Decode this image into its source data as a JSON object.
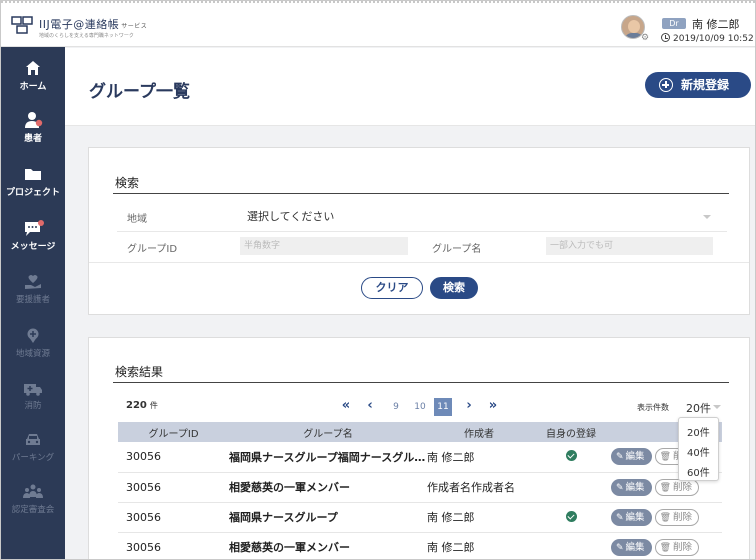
{
  "app": {
    "brand": "IIJ電子@連絡帳",
    "brand_suffix": "サービス",
    "tagline": "地域のくらしを支える専門職ネットワーク"
  },
  "user": {
    "badge": "Dr",
    "name": "南 修二郎",
    "datetime": "2019/10/09 10:52"
  },
  "sidebar": {
    "items": [
      {
        "label": "ホーム",
        "icon": "home-icon",
        "enabled": true
      },
      {
        "label": "患者",
        "icon": "patient-icon",
        "enabled": true
      },
      {
        "label": "プロジェクト",
        "icon": "folder-icon",
        "enabled": true
      },
      {
        "label": "メッセージ",
        "icon": "message-icon",
        "enabled": true
      },
      {
        "label": "要援護者",
        "icon": "care-icon",
        "enabled": false
      },
      {
        "label": "地域資源",
        "icon": "location-icon",
        "enabled": false
      },
      {
        "label": "消防",
        "icon": "ambulance-icon",
        "enabled": false
      },
      {
        "label": "パーキング",
        "icon": "car-icon",
        "enabled": false
      },
      {
        "label": "認定審査会",
        "icon": "committee-icon",
        "enabled": false
      }
    ]
  },
  "page": {
    "title": "グループ一覧",
    "new_button": "新規登録"
  },
  "search": {
    "title": "検索",
    "region_label": "地域",
    "region_value": "選択してください",
    "group_id_label": "グループID",
    "group_id_placeholder": "半角数字",
    "group_name_label": "グループ名",
    "group_name_placeholder": "一部入力でも可",
    "clear_button": "クリア",
    "search_button": "検索"
  },
  "results": {
    "title": "検索結果",
    "count": "220",
    "count_unit": "件",
    "pagination": {
      "first": "«",
      "prev": "‹",
      "pages": [
        "9",
        "10",
        "11"
      ],
      "current": "11",
      "next": "›",
      "last": "»"
    },
    "per_page_label": "表示件数",
    "per_page_value": "20件",
    "per_page_options": [
      "20件",
      "40件",
      "60件"
    ],
    "columns": [
      "グループID",
      "グループ名",
      "作成者",
      "自身の登録",
      ""
    ],
    "edit_label": "編集",
    "delete_label": "削除",
    "rows": [
      {
        "id": "30056",
        "name": "福岡県ナースグループ福岡ナースグループ",
        "creator": "南 修二郎",
        "registered": true
      },
      {
        "id": "30056",
        "name": "相愛慈英の一軍メンバー",
        "creator": "作成者名作成者名",
        "registered": false
      },
      {
        "id": "30056",
        "name": "福岡県ナースグループ",
        "creator": "南 修二郎",
        "registered": true
      },
      {
        "id": "30056",
        "name": "相愛慈英の一軍メンバー",
        "creator": "南 修二郎",
        "registered": false
      }
    ]
  },
  "colors": {
    "sidebar": "#2c3a56",
    "accent": "#2a4a86",
    "check": "#2f7d5f"
  }
}
